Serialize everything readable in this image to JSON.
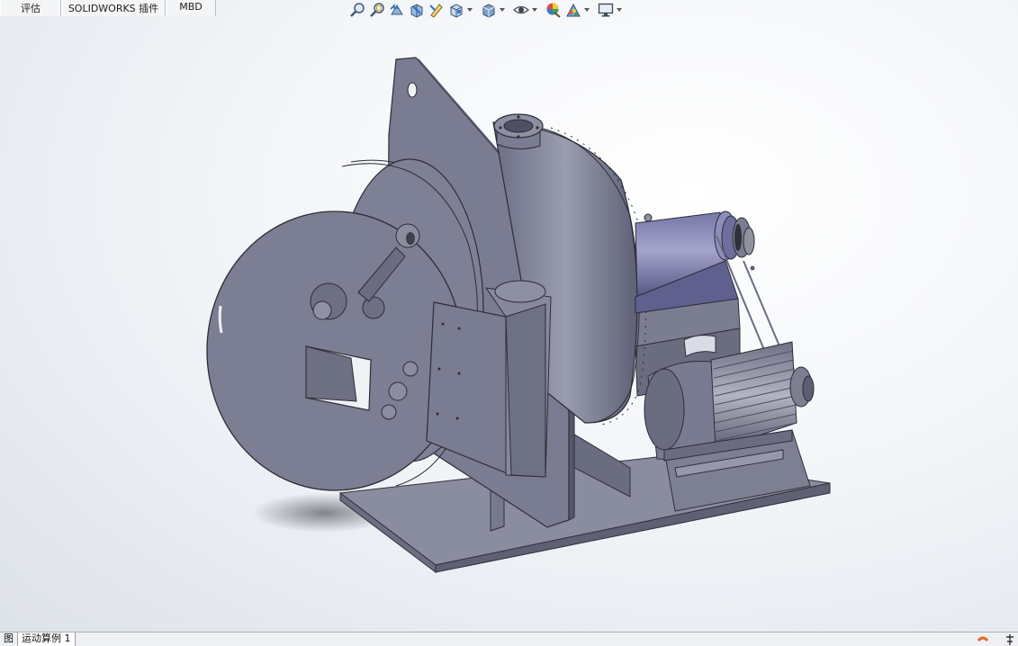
{
  "command_manager": {
    "tabs": [
      {
        "label": "评估"
      },
      {
        "label": "SOLIDWORKS 插件"
      },
      {
        "label": "MBD"
      }
    ]
  },
  "heads_up_toolbar": {
    "icons": [
      "zoom-to-fit-icon",
      "zoom-to-area-icon",
      "previous-view-icon",
      "section-view-icon",
      "dynamic-annotation-icon",
      "view-orientation-icon",
      "display-style-icon",
      "hide-show-icon",
      "edit-appearance-icon",
      "apply-scene-icon",
      "view-settings-icon"
    ]
  },
  "model": {
    "description_icon": "3d-assembly-model"
  },
  "bottom_tabs": [
    {
      "label": "图"
    },
    {
      "label": "运动算例 1"
    }
  ],
  "colors": {
    "part_fill": "#7c7f95",
    "part_dark": "#5b5e72",
    "part_light": "#9396a9",
    "motor_accent": "#8585b3",
    "accent_orange": "#e8671d"
  }
}
